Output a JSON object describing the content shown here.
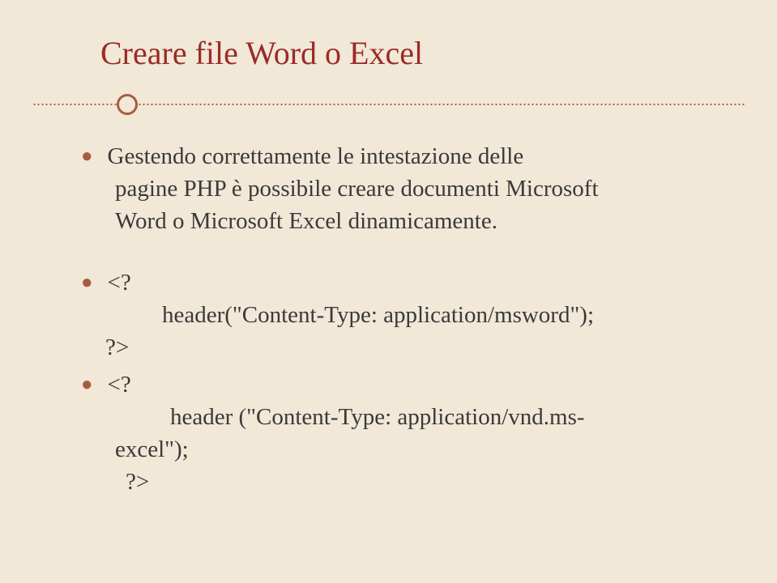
{
  "title": "Creare file Word o Excel",
  "intro": {
    "line1": "Gestendo correttamente le intestazione delle",
    "line2": "pagine PHP è possibile creare documenti Microsoft",
    "line3": "Word  o Microsoft Excel dinamicamente."
  },
  "code1": {
    "open": "<?",
    "body": "header(\"Content-Type: application/msword\");",
    "close": "?>"
  },
  "code2": {
    "open": "<?",
    "body_line1": "header (\"Content-Type: application/vnd.ms-",
    "body_line2": "excel\");",
    "close": "?>"
  }
}
